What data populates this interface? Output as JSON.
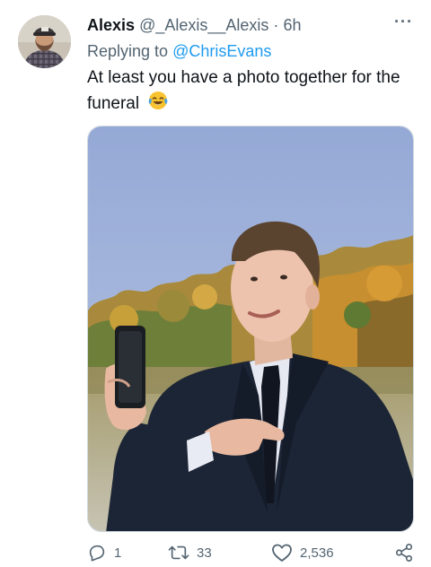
{
  "tweet": {
    "display_name": "Alexis",
    "handle": "@_Alexis__Alexis",
    "separator": "·",
    "time": "6h",
    "more_label": "···",
    "replying_prefix": "Replying to ",
    "replying_to": "@ChrisEvans",
    "text": "At least you have a photo together for the funeral",
    "emoji": "face-with-tears-of-joy"
  },
  "actions": {
    "replies": "1",
    "retweets": "33",
    "likes": "2,536"
  },
  "icons": [
    "reply-icon",
    "retweet-icon",
    "like-icon",
    "share-icon",
    "more-icon"
  ],
  "colors": {
    "link": "#1d9bf0",
    "secondary_text": "#536471",
    "primary_text": "#0f1419"
  }
}
